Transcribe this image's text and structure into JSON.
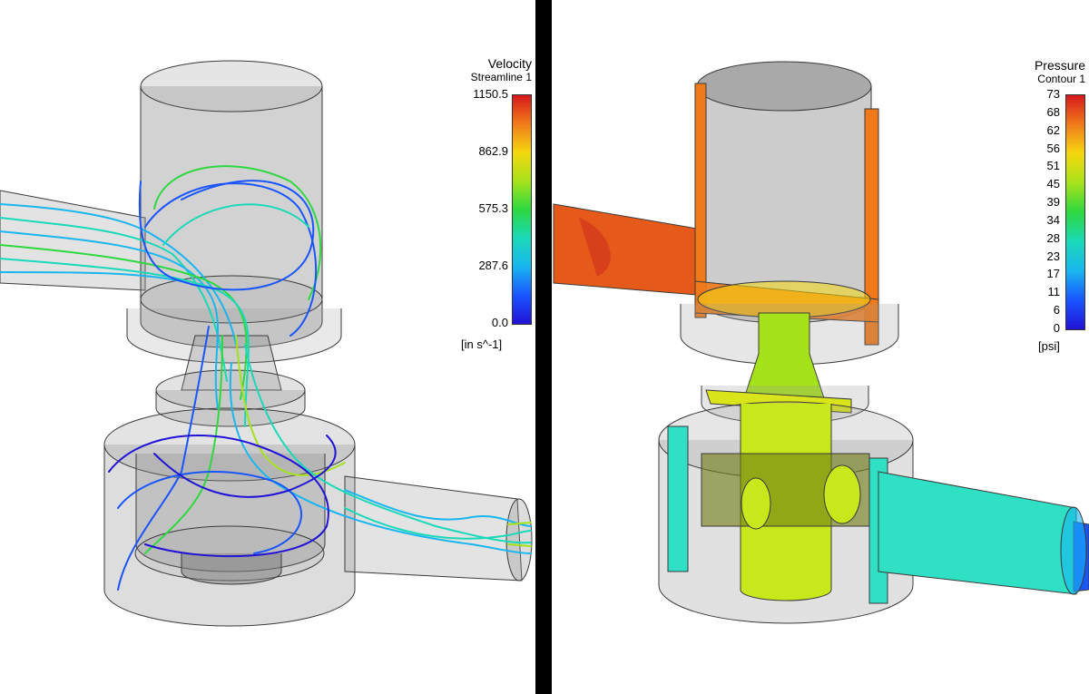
{
  "velocity_legend": {
    "title": "Velocity",
    "subtitle": "Streamline 1",
    "ticks": [
      "1150.5",
      "862.9",
      "575.3",
      "287.6",
      "0.0"
    ],
    "unit": "[in s^-1]",
    "colormap": [
      "#d7191c",
      "#f07a1a",
      "#f5d80f",
      "#a6e21a",
      "#2ed840",
      "#1ad9b8",
      "#19b6ef",
      "#1a55ff",
      "#2212d6"
    ]
  },
  "pressure_legend": {
    "title": "Pressure",
    "subtitle": "Contour 1",
    "ticks": [
      "73",
      "68",
      "62",
      "56",
      "51",
      "45",
      "39",
      "34",
      "28",
      "23",
      "17",
      "11",
      "6",
      "0"
    ],
    "unit": "[psi]",
    "colormap": [
      "#d7191c",
      "#f07a1a",
      "#f5d80f",
      "#a6e21a",
      "#2ed840",
      "#1ad9b8",
      "#19b6ef",
      "#1a55ff",
      "#2212d6"
    ]
  },
  "colors": {
    "divider": "#000000",
    "geometry_fill": "#9a9a9a",
    "geometry_edge": "#3a3a3a",
    "pressure_high": "#e0461e",
    "pressure_mid": "#c8e81c",
    "pressure_low": "#2fe0c4",
    "pressure_min": "#1a55ff"
  }
}
